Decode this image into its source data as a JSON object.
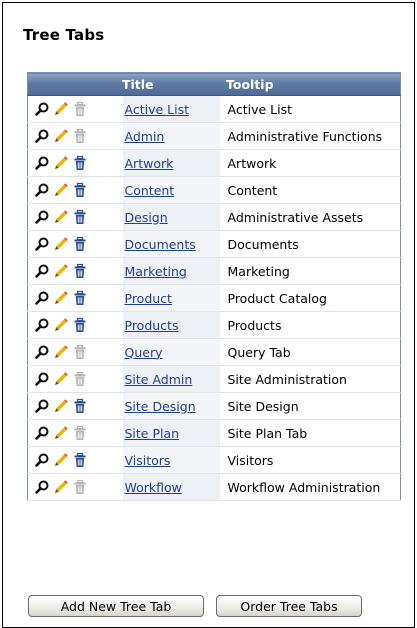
{
  "page": {
    "title": "Tree Tabs"
  },
  "table": {
    "columns": {
      "title": "Title",
      "tooltip": "Tooltip"
    },
    "rows": [
      {
        "title": "Active List",
        "tooltip": "Active List",
        "delete_enabled": false
      },
      {
        "title": "Admin",
        "tooltip": "Administrative Functions",
        "delete_enabled": false
      },
      {
        "title": "Artwork",
        "tooltip": "Artwork",
        "delete_enabled": true
      },
      {
        "title": "Content",
        "tooltip": "Content",
        "delete_enabled": true
      },
      {
        "title": "Design",
        "tooltip": "Administrative Assets",
        "delete_enabled": true
      },
      {
        "title": "Documents",
        "tooltip": "Documents",
        "delete_enabled": true
      },
      {
        "title": "Marketing",
        "tooltip": "Marketing",
        "delete_enabled": true
      },
      {
        "title": "Product",
        "tooltip": "Product Catalog",
        "delete_enabled": true
      },
      {
        "title": "Products",
        "tooltip": "Products",
        "delete_enabled": true
      },
      {
        "title": "Query",
        "tooltip": "Query Tab",
        "delete_enabled": false
      },
      {
        "title": "Site Admin",
        "tooltip": "Site Administration",
        "delete_enabled": false
      },
      {
        "title": "Site Design",
        "tooltip": "Site Design",
        "delete_enabled": true
      },
      {
        "title": "Site Plan",
        "tooltip": "Site Plan Tab",
        "delete_enabled": false
      },
      {
        "title": "Visitors",
        "tooltip": "Visitors",
        "delete_enabled": true
      },
      {
        "title": "Workflow",
        "tooltip": "Workflow Administration",
        "delete_enabled": false
      }
    ]
  },
  "buttons": {
    "add": "Add New Tree Tab",
    "order": "Order Tree Tabs"
  },
  "icons": {
    "view": "magnifier-icon",
    "edit": "pencil-icon",
    "delete": "trash-can-icon"
  },
  "colors": {
    "header": "#5f7ba5",
    "link": "#1f3f94",
    "pencil": "#f0b400",
    "trash_enabled": "#2d4f8c",
    "trash_disabled": "#b5b5b5"
  }
}
